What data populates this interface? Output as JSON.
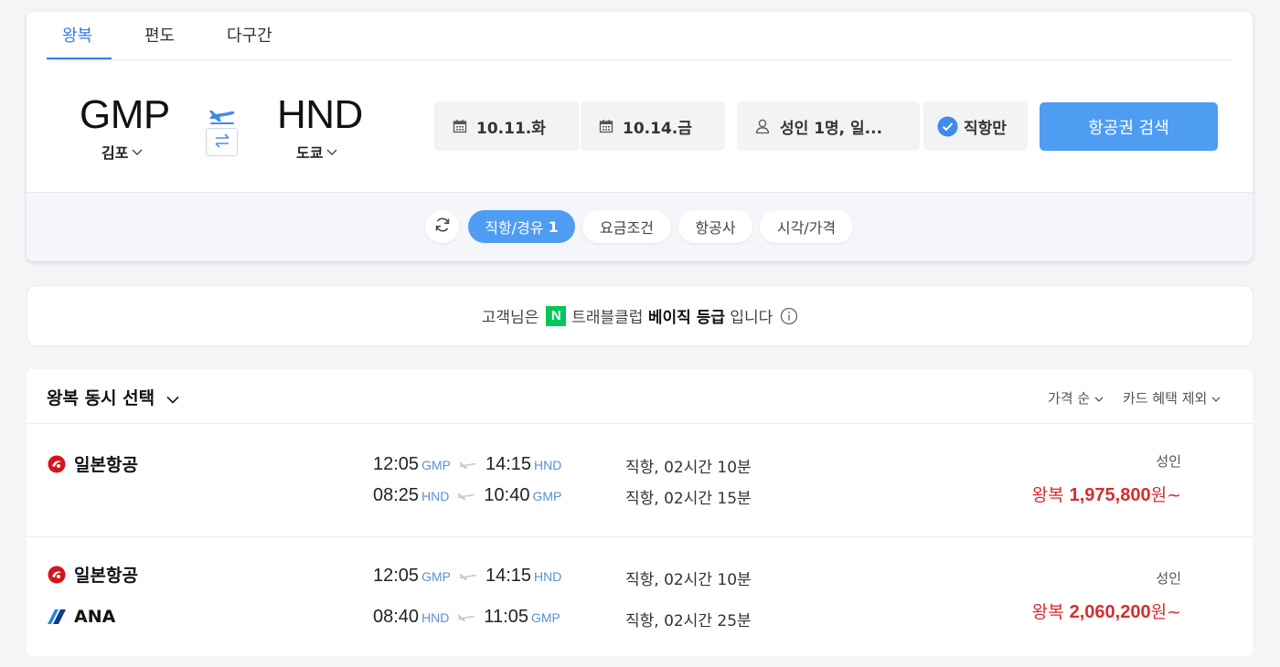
{
  "tabs": [
    {
      "label": "왕복",
      "active": true
    },
    {
      "label": "편도",
      "active": false
    },
    {
      "label": "다구간",
      "active": false
    }
  ],
  "route": {
    "origin": {
      "code": "GMP",
      "city": "김포"
    },
    "destination": {
      "code": "HND",
      "city": "도쿄"
    }
  },
  "dates": {
    "depart": "10.11.화",
    "return": "10.14.금"
  },
  "passengers": "성인 1명, 일...",
  "direct_only": {
    "label": "직항만",
    "checked": true
  },
  "search_button": "항공권 검색",
  "filters": [
    {
      "label": "직항/경유",
      "count": "1",
      "active": true
    },
    {
      "label": "요금조건",
      "active": false
    },
    {
      "label": "항공사",
      "active": false
    },
    {
      "label": "시각/가격",
      "active": false
    }
  ],
  "grade_banner": {
    "prefix": "고객님은",
    "badge": "N",
    "club": "트래블클럽",
    "grade": "베이직 등급",
    "suffix": "입니다"
  },
  "results": {
    "title": "왕복 동시 선택",
    "sort": "가격 순",
    "card_option": "카드 혜택 제외",
    "items": [
      {
        "airline_top": "일본항공",
        "airline_bottom": "",
        "legs": [
          {
            "dep_time": "12:05",
            "dep": "GMP",
            "arr_time": "14:15",
            "arr": "HND",
            "duration": "직항, 02시간 10분"
          },
          {
            "dep_time": "08:25",
            "dep": "HND",
            "arr_time": "10:40",
            "arr": "GMP",
            "duration": "직항, 02시간 15분"
          }
        ],
        "pax": "성인",
        "price_prefix": "왕복",
        "price": "1,975,800",
        "price_suffix": "원~"
      },
      {
        "airline_top": "일본항공",
        "airline_bottom": "ANA",
        "legs": [
          {
            "dep_time": "12:05",
            "dep": "GMP",
            "arr_time": "14:15",
            "arr": "HND",
            "duration": "직항, 02시간 10분"
          },
          {
            "dep_time": "08:40",
            "dep": "HND",
            "arr_time": "11:05",
            "arr": "GMP",
            "duration": "직항, 02시간 25분"
          }
        ],
        "pax": "성인",
        "price_prefix": "왕복",
        "price": "2,060,200",
        "price_suffix": "원~"
      }
    ]
  },
  "colors": {
    "accent": "#4f9cf3",
    "tab_active": "#2f7de1",
    "price": "#d62e2e",
    "airport_code": "#5c8fd6",
    "naver_green": "#03c75a",
    "jal_red": "#d7141a",
    "ana_blue": "#0b3d91"
  }
}
